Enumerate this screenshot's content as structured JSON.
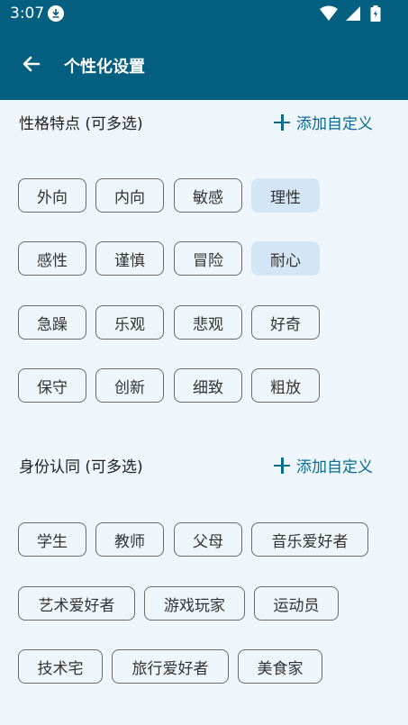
{
  "status": {
    "time": "3:07"
  },
  "appbar": {
    "title": "个性化设置"
  },
  "sections": {
    "personality": {
      "title": "性格特点 (可多选)",
      "add_label": "添加自定义",
      "chips": [
        {
          "label": "外向",
          "selected": false
        },
        {
          "label": "内向",
          "selected": false
        },
        {
          "label": "敏感",
          "selected": false
        },
        {
          "label": "理性",
          "selected": true
        },
        {
          "label": "感性",
          "selected": false
        },
        {
          "label": "谨慎",
          "selected": false
        },
        {
          "label": "冒险",
          "selected": false
        },
        {
          "label": "耐心",
          "selected": true
        },
        {
          "label": "急躁",
          "selected": false
        },
        {
          "label": "乐观",
          "selected": false
        },
        {
          "label": "悲观",
          "selected": false
        },
        {
          "label": "好奇",
          "selected": false
        },
        {
          "label": "保守",
          "selected": false
        },
        {
          "label": "创新",
          "selected": false
        },
        {
          "label": "细致",
          "selected": false
        },
        {
          "label": "粗放",
          "selected": false
        }
      ]
    },
    "identity": {
      "title": "身份认同 (可多选)",
      "add_label": "添加自定义",
      "chips": [
        {
          "label": "学生",
          "selected": false
        },
        {
          "label": "教师",
          "selected": false
        },
        {
          "label": "父母",
          "selected": false
        },
        {
          "label": "音乐爱好者",
          "selected": false
        },
        {
          "label": "艺术爱好者",
          "selected": false
        },
        {
          "label": "游戏玩家",
          "selected": false
        },
        {
          "label": "运动员",
          "selected": false
        },
        {
          "label": "技术宅",
          "selected": false
        },
        {
          "label": "旅行爱好者",
          "selected": false
        },
        {
          "label": "美食家",
          "selected": false
        }
      ]
    }
  },
  "colors": {
    "appbar": "#045f80",
    "accent": "#0a6b8f",
    "selected_chip": "#d4e6f5",
    "background": "#eef6fb"
  }
}
